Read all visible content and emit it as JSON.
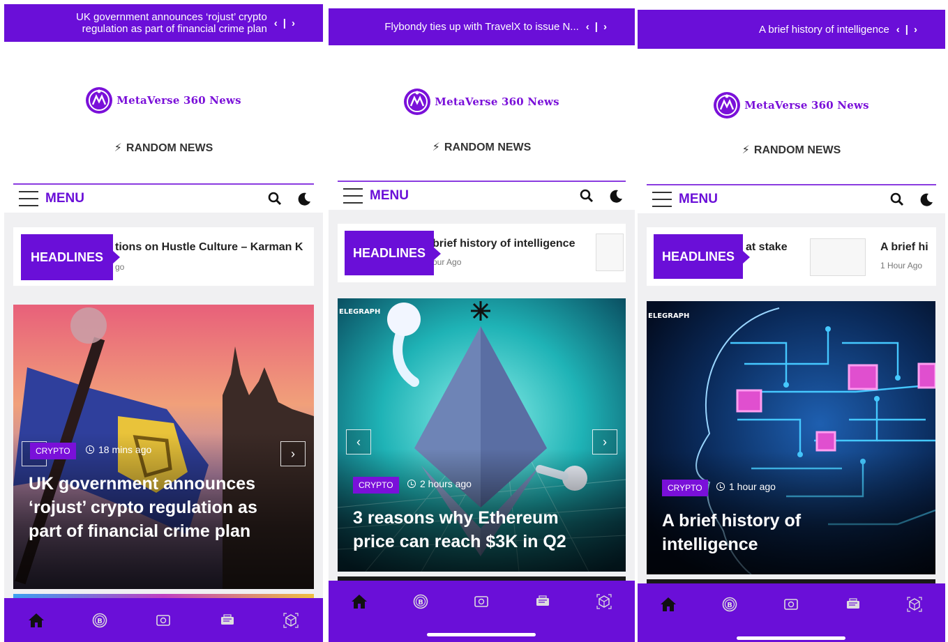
{
  "colors": {
    "brand": "#6a0fd8",
    "logo": "#7a10d9",
    "menu_rule": "#8a3be0"
  },
  "screens": [
    {
      "ticker": {
        "text": "UK government announces ‘rojust’ crypto regulation as part of financial crime plan",
        "prev": "‹",
        "sep": "|",
        "next": "›"
      },
      "logo": {
        "text": "MetaVerse 360 News"
      },
      "random_news": "RANDOM NEWS",
      "menu": {
        "label": "MENU"
      },
      "headlines": {
        "badge": "HEADLINES",
        "text": "tions on Hustle Culture – Karman K",
        "time": "go"
      },
      "hero": {
        "category": "CRYPTO",
        "time": "18 mins ago",
        "title": "UK government announces ‘rojust’ crypto regulation as part of financial crime plan"
      }
    },
    {
      "ticker": {
        "text": "Flybondy ties up with TravelX to issue N...",
        "prev": "‹",
        "sep": "|",
        "next": "›"
      },
      "logo": {
        "text": "MetaVerse 360 News"
      },
      "random_news": "RANDOM NEWS",
      "menu": {
        "label": "MENU"
      },
      "headlines": {
        "badge": "HEADLINES",
        "text": "brief history of intelligence",
        "time": "our Ago"
      },
      "hero": {
        "category": "CRYPTO",
        "time": "2 hours ago",
        "title": "3 reasons why Ethereum price can reach $3K in Q2",
        "watermark": "ELEGRAPH"
      }
    },
    {
      "ticker": {
        "text": "A brief history of intelligence",
        "prev": "‹",
        "sep": "|",
        "next": "›"
      },
      "logo": {
        "text": "MetaVerse 360 News"
      },
      "random_news": "RANDOM NEWS",
      "menu": {
        "label": "MENU"
      },
      "headlines": {
        "badge": "HEADLINES",
        "text": "at stake",
        "text2": "A brief hi",
        "time2": "1 Hour Ago"
      },
      "hero": {
        "category": "CRYPTO",
        "time": "1 hour ago",
        "title": "A brief history of intelligence",
        "watermark": "ELEGRAPH"
      }
    }
  ],
  "icons": {
    "nav": [
      "home-icon",
      "bitcoin-icon",
      "wallet-icon",
      "ticket-icon",
      "cube-icon"
    ]
  }
}
